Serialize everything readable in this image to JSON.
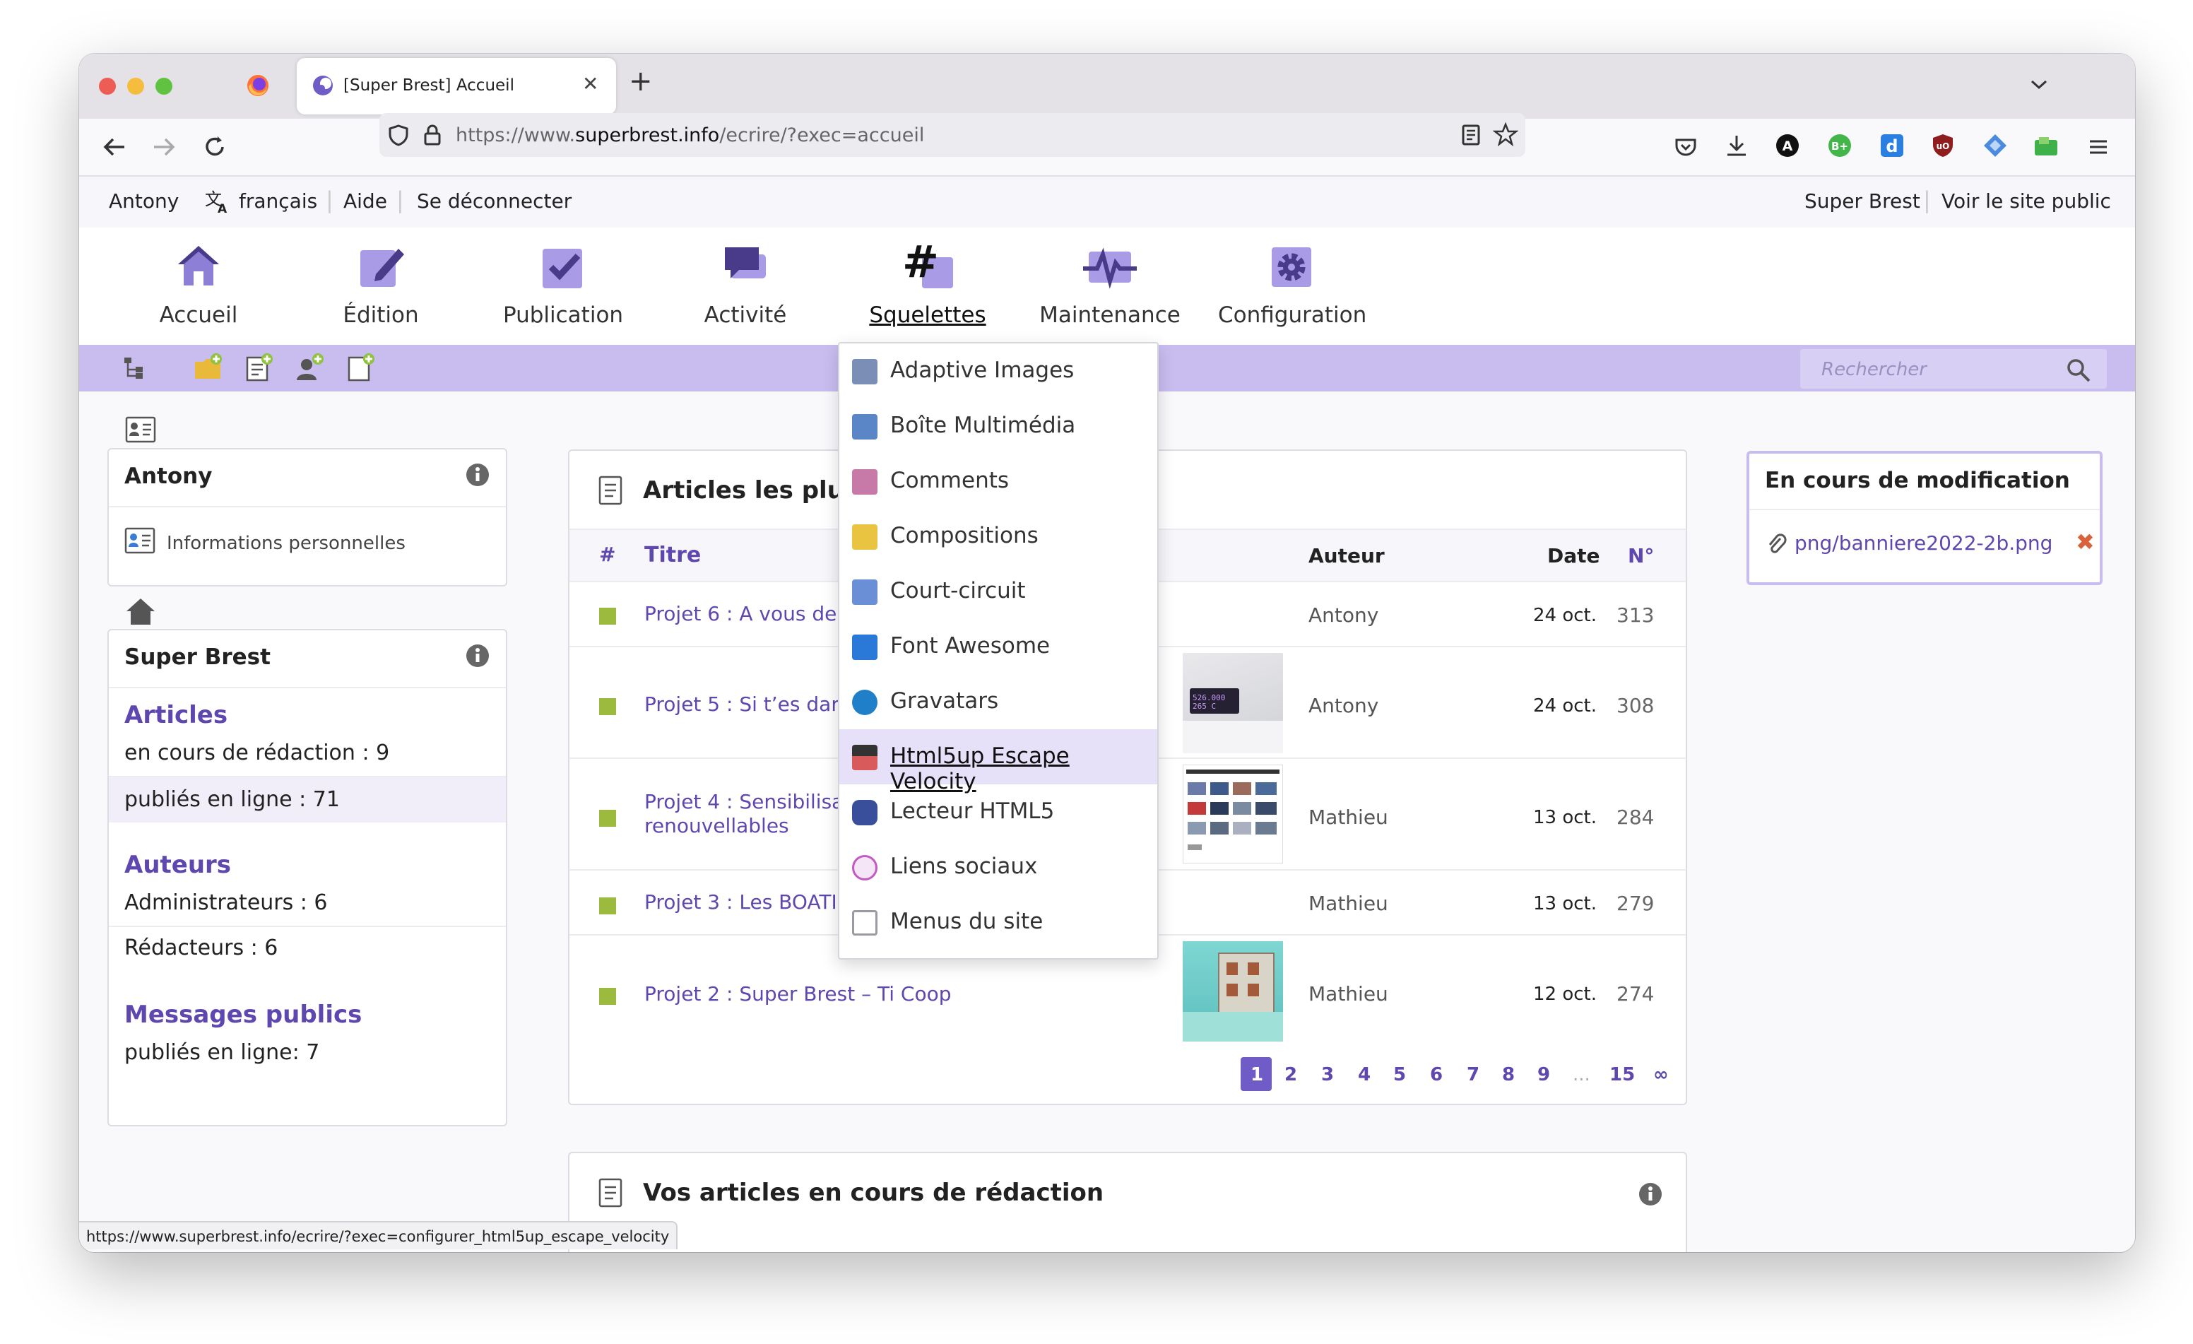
{
  "browser": {
    "tab_title": "[Super Brest] Accueil",
    "url_prefix": "https://www.",
    "url_domain": "superbrest.info",
    "url_path": "/ecrire/?exec=accueil",
    "status_url": "https://www.superbrest.info/ecrire/?exec=configurer_html5up_escape_velocity"
  },
  "topbar": {
    "user": "Antony",
    "language": "français",
    "help": "Aide",
    "logout": "Se déconnecter",
    "site_name": "Super Brest",
    "view_public": "Voir le site public"
  },
  "main_menu": [
    {
      "label": "Accueil"
    },
    {
      "label": "Édition"
    },
    {
      "label": "Publication"
    },
    {
      "label": "Activité"
    },
    {
      "label": "Squelettes"
    },
    {
      "label": "Maintenance"
    },
    {
      "label": "Configuration"
    }
  ],
  "search": {
    "placeholder": "Rechercher"
  },
  "dropdown": [
    {
      "label": "Adaptive Images",
      "color": "#7b8fb6"
    },
    {
      "label": "Boîte Multimédia",
      "color": "#5a86c8"
    },
    {
      "label": "Comments",
      "color": "#c77aa8"
    },
    {
      "label": "Compositions",
      "color": "#e8c440"
    },
    {
      "label": "Court-circuit",
      "color": "#6b8fd6"
    },
    {
      "label": "Font Awesome",
      "color": "#2a78d8"
    },
    {
      "label": "Gravatars",
      "color": "#1f7fc9"
    },
    {
      "label": "Html5up Escape Velocity",
      "color": "#d85a5a"
    },
    {
      "label": "Lecteur HTML5",
      "color": "#3a4f9c"
    },
    {
      "label": "Liens sociaux",
      "color": "#c25ac2"
    },
    {
      "label": "Menus du site",
      "color": "#9a9aa2"
    }
  ],
  "user_box": {
    "name": "Antony",
    "link": "Informations personnelles"
  },
  "site_box": {
    "name": "Super Brest",
    "articles_title": "Articles",
    "articles_draft": "en cours de rédaction : 9",
    "articles_online": "publiés en ligne : 71",
    "authors_title": "Auteurs",
    "admins": "Administrateurs : 6",
    "editors": "Rédacteurs : 6",
    "messages_title": "Messages publics",
    "messages_online": "publiés en ligne: 7"
  },
  "articles": {
    "title": "Articles les plus",
    "col_hash": "#",
    "col_title": "Titre",
    "col_author": "Auteur",
    "col_date": "Date",
    "col_num": "N°",
    "rows": [
      {
        "title": "Projet 6 : A vous de",
        "author": "Antony",
        "date": "24 oct.",
        "num": "313"
      },
      {
        "title": "Projet 5 : Si t’es dar",
        "author": "Antony",
        "date": "24 oct.",
        "num": "308"
      },
      {
        "title": "Projet 4 : Sensibilisa",
        "title2": "renouvellables",
        "author": "Mathieu",
        "date": "13 oct.",
        "num": "284"
      },
      {
        "title": "Projet 3 : Les BOATI",
        "author": "Mathieu",
        "date": "13 oct.",
        "num": "279"
      },
      {
        "title": "Projet 2 : Super Brest – Ti Coop",
        "author": "Mathieu",
        "date": "12 oct.",
        "num": "274"
      }
    ],
    "thumb_text": "526.000 265 C",
    "pages": [
      "1",
      "2",
      "3",
      "4",
      "5",
      "6",
      "7",
      "8",
      "9",
      "...",
      "15",
      "∞"
    ]
  },
  "drafts": {
    "title": "Vos articles en cours de rédaction"
  },
  "editing": {
    "title": "En cours de modification",
    "file": "png/banniere2022-2b.png"
  }
}
